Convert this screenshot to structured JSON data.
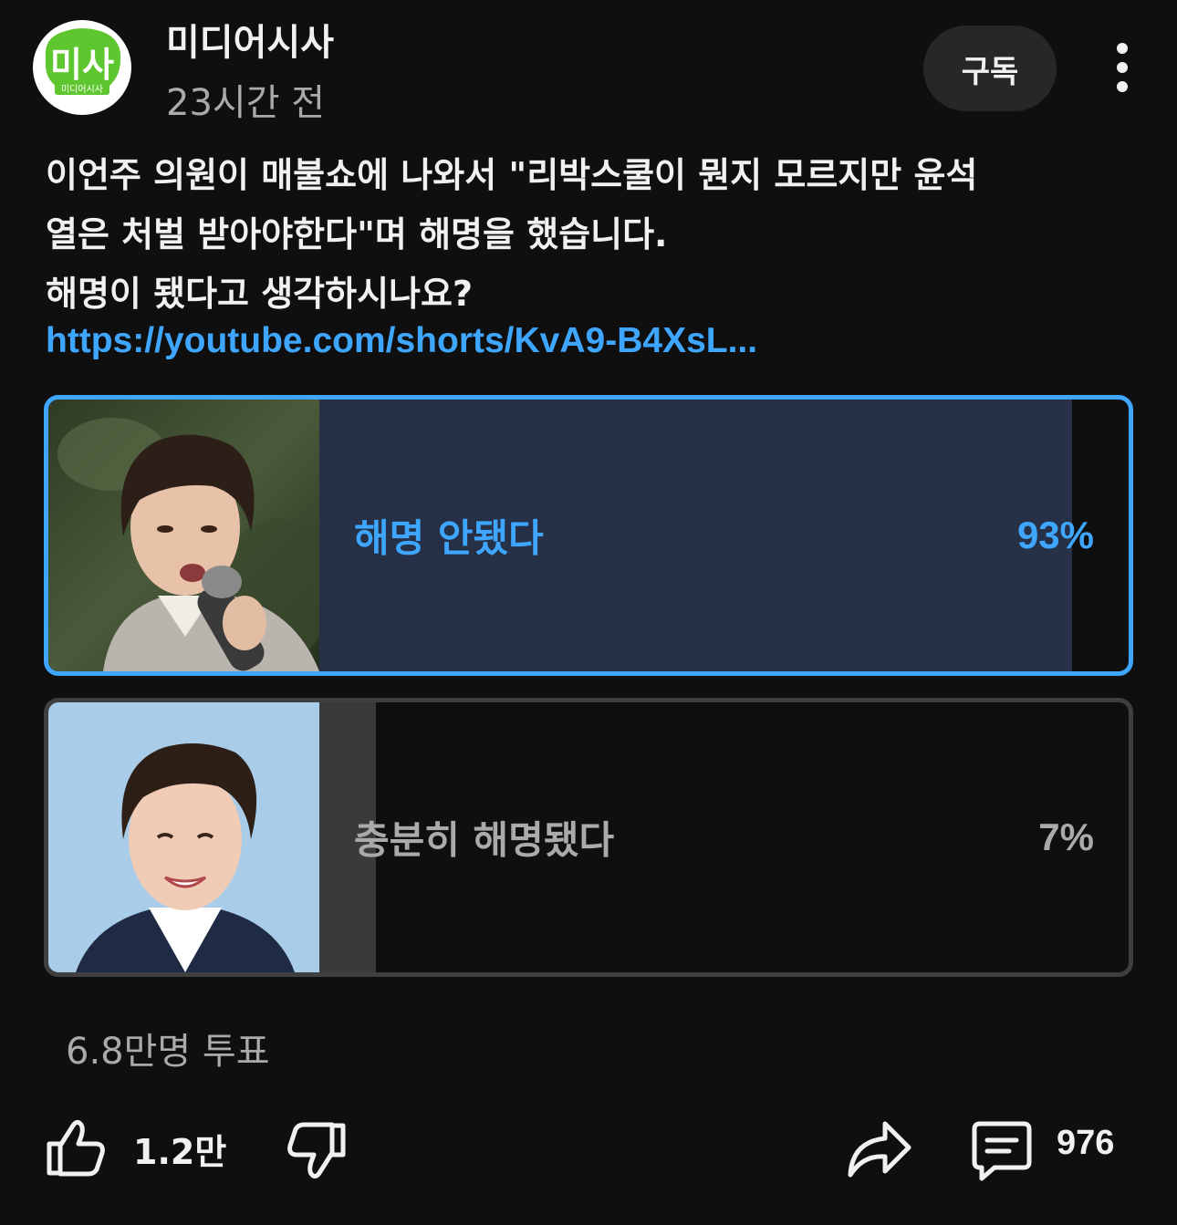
{
  "channel": {
    "name": "미디어시사",
    "time": "23시간 전",
    "logo_text": "미사",
    "logo_subtext": "미디어시사",
    "subscribe_label": "구독"
  },
  "post": {
    "text_lines": [
      "이언주 의원이 매불쇼에 나와서 \"리박스쿨이 뭔지 모르지만 윤석",
      "열은 처벌 받아야한다\"며 해명을 했습니다.",
      "해명이 됐다고 생각하시나요?"
    ],
    "link": "https://youtube.com/shorts/KvA9-B4XsL..."
  },
  "poll": {
    "options": [
      {
        "label": "해명 안됐다",
        "percent_text": "93%",
        "percent": 93,
        "selected": true
      },
      {
        "label": "충분히 해명됐다",
        "percent_text": "7%",
        "percent": 7,
        "selected": false
      }
    ],
    "vote_count": "6.8만명 투표"
  },
  "actions": {
    "like_count": "1.2만",
    "comment_count": "976"
  },
  "colors": {
    "background": "#0f0f0f",
    "accent": "#3ea6ff",
    "selected_fill": "#263047",
    "unselected_fill": "#3a3a3a",
    "logo_green": "#5ec72f"
  },
  "icons": [
    "more-vertical-icon",
    "thumbs-up-icon",
    "thumbs-down-icon",
    "share-icon",
    "comment-icon"
  ]
}
